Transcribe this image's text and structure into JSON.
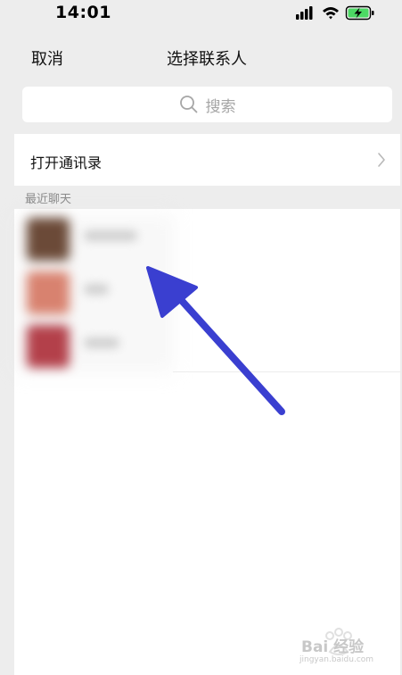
{
  "status_bar": {
    "time": "14:01"
  },
  "nav": {
    "cancel_label": "取消",
    "title": "选择联系人"
  },
  "search": {
    "placeholder": "搜索"
  },
  "contacts_entry": {
    "label": "打开通讯录"
  },
  "recent_section": {
    "label": "最近聊天"
  },
  "recent_chats": [
    {
      "avatar_color": "#6b4a38"
    },
    {
      "avatar_color": "#d8826f"
    },
    {
      "avatar_color": "#b3404a"
    }
  ],
  "annotation": {
    "arrow_color": "#3a3fd0"
  },
  "watermark": {
    "text": "Bai 经验",
    "sub": "jingyan.baidu.com"
  }
}
